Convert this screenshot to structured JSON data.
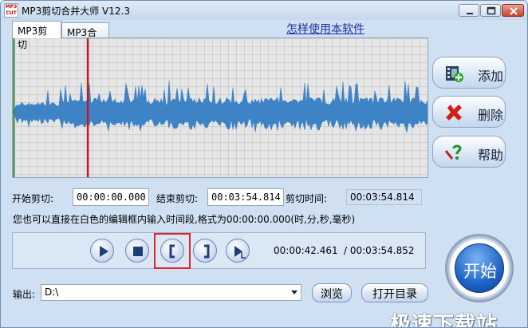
{
  "window": {
    "title": "MP3剪切合并大师 V12.3",
    "icon_lines": [
      "MP3",
      "CUT"
    ]
  },
  "tabs": [
    {
      "label": "MP3剪切",
      "active": true
    },
    {
      "label": "MP3合并",
      "active": false
    }
  ],
  "help_link": "怎样使用本软件",
  "waveform": {
    "color": "#3f83c7",
    "cursor_color": "#c01820",
    "cursor_position_fraction": 0.181,
    "start_marker_color": "#2e8a2e"
  },
  "side_buttons": {
    "add_label": "添加",
    "delete_label": "删除",
    "help_label": "帮助"
  },
  "times": {
    "start_label": "开始剪切:",
    "start_value": "00:00:00.000",
    "end_label": "结束剪切:",
    "end_value": "00:03:54.814",
    "duration_label": "剪切时间:",
    "duration_value": "00:03:54.814"
  },
  "hint": "您也可以直接在白色的编辑框内输入时间段,格式为00:00:00.000(时,分,秒,毫秒)",
  "playback": {
    "current_time": "00:00:42.461",
    "total_time": "/ 00:03:54.852",
    "controls": [
      "play-icon",
      "stop-icon",
      "set-start-icon",
      "set-end-icon",
      "play-selection-icon"
    ]
  },
  "start_button": "开始",
  "output": {
    "label": "输出:",
    "path": "D:\\",
    "browse_label": "浏览",
    "open_dir_label": "打开目录"
  },
  "watermark": "极速下载站",
  "colors": {
    "highlight": "#e0262b",
    "link": "#1a2ea8",
    "start_button": "#1e63c4"
  }
}
